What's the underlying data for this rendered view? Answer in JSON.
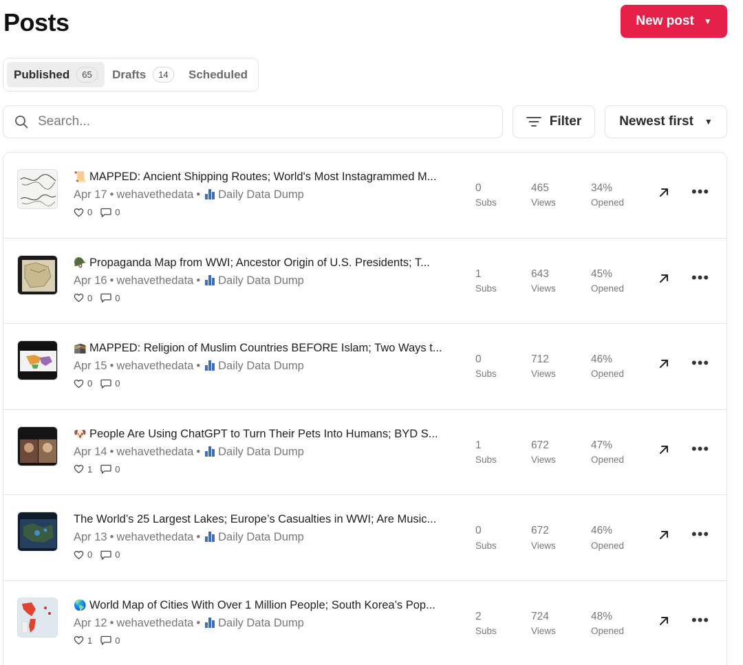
{
  "header": {
    "title": "Posts",
    "new_post_label": "New post"
  },
  "tabs": [
    {
      "label": "Published",
      "count": "65"
    },
    {
      "label": "Drafts",
      "count": "14"
    },
    {
      "label": "Scheduled"
    }
  ],
  "search": {
    "placeholder": "Search..."
  },
  "filter_label": "Filter",
  "sort_label": "Newest first",
  "labels": {
    "subs": "Subs",
    "views": "Views",
    "opened": "Opened"
  },
  "posts": [
    {
      "emoji": "📜",
      "title": "MAPPED: Ancient Shipping Routes; World's Most Instagrammed M...",
      "date": "Apr 17",
      "author": "wehavethedata",
      "publication": "Daily Data Dump",
      "likes": "0",
      "comments": "0",
      "subs": "0",
      "views": "465",
      "opened": "34%"
    },
    {
      "emoji": "🪖",
      "title": "Propaganda Map from WWI; Ancestor Origin of U.S. Presidents; T...",
      "date": "Apr 16",
      "author": "wehavethedata",
      "publication": "Daily Data Dump",
      "likes": "0",
      "comments": "0",
      "subs": "1",
      "views": "643",
      "opened": "45%"
    },
    {
      "emoji": "🕋",
      "title": "MAPPED: Religion of Muslim Countries BEFORE Islam; Two Ways t...",
      "date": "Apr 15",
      "author": "wehavethedata",
      "publication": "Daily Data Dump",
      "likes": "0",
      "comments": "0",
      "subs": "0",
      "views": "712",
      "opened": "46%"
    },
    {
      "emoji": "🐶",
      "title": "People Are Using ChatGPT to Turn Their Pets Into Humans; BYD S...",
      "date": "Apr 14",
      "author": "wehavethedata",
      "publication": "Daily Data Dump",
      "likes": "1",
      "comments": "0",
      "subs": "1",
      "views": "672",
      "opened": "47%"
    },
    {
      "emoji": "",
      "title": "The World’s 25 Largest Lakes; Europe’s Casualties in WWI; Are Music...",
      "date": "Apr 13",
      "author": "wehavethedata",
      "publication": "Daily Data Dump",
      "likes": "0",
      "comments": "0",
      "subs": "0",
      "views": "672",
      "opened": "46%"
    },
    {
      "emoji": "🌎",
      "title": "World Map of Cities With Over 1 Million People; South Korea’s Pop...",
      "date": "Apr 12",
      "author": "wehavethedata",
      "publication": "Daily Data Dump",
      "likes": "1",
      "comments": "0",
      "subs": "2",
      "views": "724",
      "opened": "48%"
    }
  ],
  "colors": {
    "accent": "#e5214a",
    "text": "#1f1f1f",
    "muted": "#777777",
    "border": "#e6e6e6"
  },
  "icons": {
    "search": "search-icon",
    "filter": "filter-icon",
    "like": "heart-icon",
    "comment": "comment-icon",
    "open": "arrow-up-right-icon",
    "more": "more-horizontal-icon",
    "caret": "caret-down-icon"
  }
}
